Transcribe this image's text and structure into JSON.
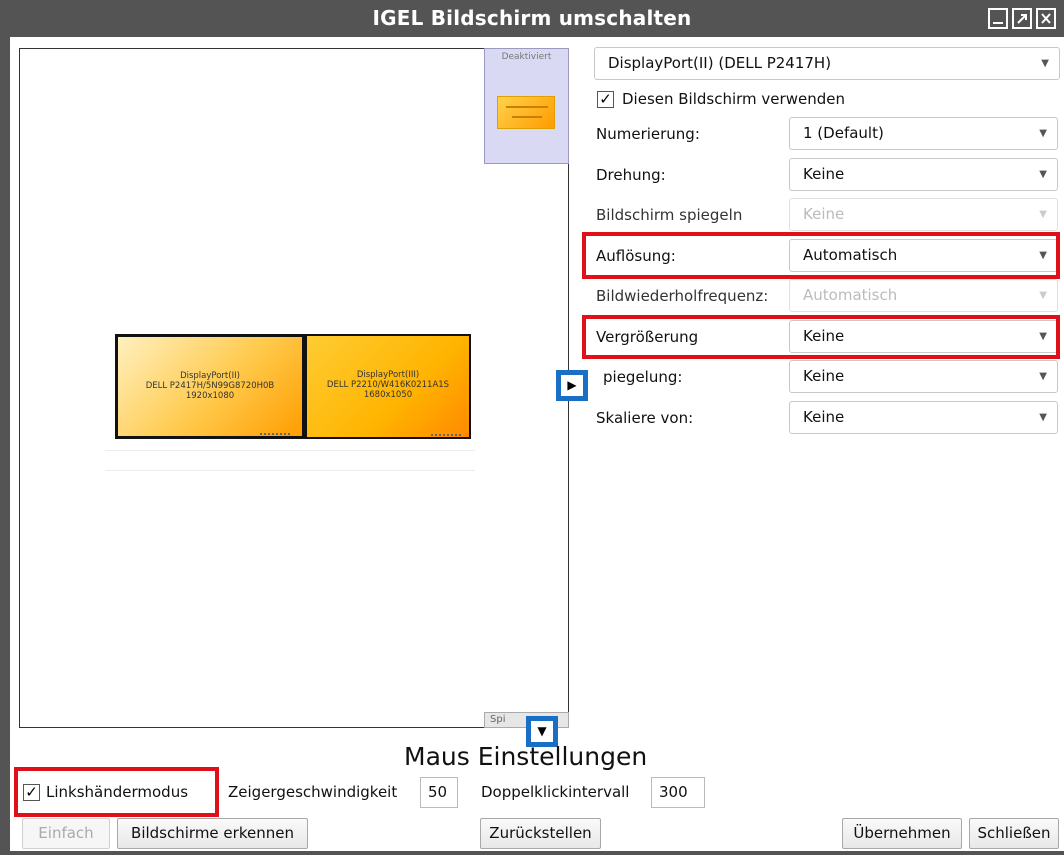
{
  "window": {
    "title": "IGEL Bildschirm umschalten"
  },
  "arrangement": {
    "disabled_label": "Deaktiviert",
    "mirror_label": "Spi",
    "monitors": [
      {
        "port": "DisplayPort(II)",
        "model": "DELL P2417H/5N99G8720H0B",
        "resolution": "1920x1080"
      },
      {
        "port": "DisplayPort(III)",
        "model": "DELL P2210/W416K0211A1S",
        "resolution": "1680x1050"
      }
    ]
  },
  "display_settings": {
    "display_select": "DisplayPort(II) (DELL P2417H)",
    "use_display_label": "Diesen Bildschirm verwenden",
    "use_display_checked": true,
    "rows": [
      {
        "label": "Numerierung:",
        "value": "1 (Default)",
        "enabled": true
      },
      {
        "label": "Drehung:",
        "value": "Keine",
        "enabled": true
      },
      {
        "label": "Bildschirm spiegeln",
        "value": "Keine",
        "enabled": false
      },
      {
        "label": "Auflösung:",
        "value": "Automatisch",
        "enabled": true
      },
      {
        "label": "Bildwiederholfrequenz:",
        "value": "Automatisch",
        "enabled": false
      },
      {
        "label": "Vergrößerung",
        "value": "Keine",
        "enabled": true
      },
      {
        "label": "piegelung:",
        "value": "Keine",
        "enabled": true
      },
      {
        "label": "Skaliere von:",
        "value": "Keine",
        "enabled": true
      }
    ]
  },
  "mouse_settings": {
    "title": "Maus Einstellungen",
    "left_handed_label": "Linkshändermodus",
    "left_handed_checked": true,
    "pointer_speed_label": "Zeigergeschwindigkeit",
    "pointer_speed_value": "50",
    "double_click_label": "Doppelklickintervall",
    "double_click_value": "300"
  },
  "buttons": {
    "simple": "Einfach",
    "detect": "Bildschirme erkennen",
    "reset": "Zurückstellen",
    "apply": "Übernehmen",
    "close": "Schließen"
  },
  "colors": {
    "titlebar": "#545454",
    "highlight": "#e0101a",
    "arrow_button": "#1a6fc4"
  }
}
